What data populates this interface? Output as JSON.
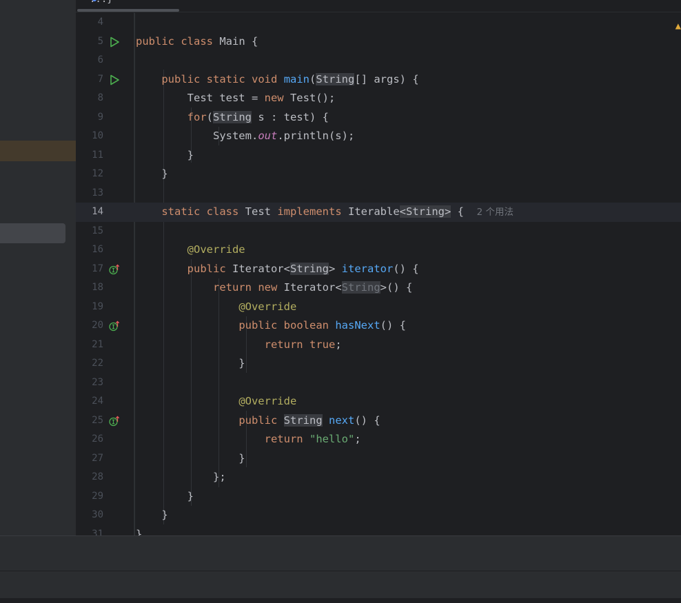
{
  "editor": {
    "tab": {
      "label": "...}"
    },
    "hint_text": "2 个用法",
    "colors": {
      "background": "#1e1f22",
      "keyword": "#cf8e6d",
      "method": "#56a8f5",
      "annotation": "#b3ae60",
      "string": "#6aab73",
      "static_field": "#c77dbb",
      "run_icon": "#4cae4f"
    },
    "lines": [
      {
        "n": "4",
        "code": ""
      },
      {
        "n": "5",
        "code": "public class Main {",
        "marker": "run"
      },
      {
        "n": "6",
        "code": ""
      },
      {
        "n": "7",
        "code": "    public static void main(String[] args) {",
        "marker": "run"
      },
      {
        "n": "8",
        "code": "        Test test = new Test();"
      },
      {
        "n": "9",
        "code": "        for(String s : test) {"
      },
      {
        "n": "10",
        "code": "            System.out.println(s);"
      },
      {
        "n": "11",
        "code": "        }"
      },
      {
        "n": "12",
        "code": "    }"
      },
      {
        "n": "13",
        "code": ""
      },
      {
        "n": "14",
        "code": "    static class Test implements Iterable<String> {  2 个用法"
      },
      {
        "n": "15",
        "code": ""
      },
      {
        "n": "16",
        "code": "        @Override"
      },
      {
        "n": "17",
        "code": "        public Iterator<String> iterator() {",
        "marker": "implements-up"
      },
      {
        "n": "18",
        "code": "            return new Iterator<String>() {"
      },
      {
        "n": "19",
        "code": "                @Override"
      },
      {
        "n": "20",
        "code": "                public boolean hasNext() {",
        "marker": "implements-up"
      },
      {
        "n": "21",
        "code": "                    return true;"
      },
      {
        "n": "22",
        "code": "                }"
      },
      {
        "n": "23",
        "code": ""
      },
      {
        "n": "24",
        "code": "                @Override"
      },
      {
        "n": "25",
        "code": "                public String next() {",
        "marker": "implements-up"
      },
      {
        "n": "26",
        "code": "                    return \"hello\";"
      },
      {
        "n": "27",
        "code": "                }"
      },
      {
        "n": "28",
        "code": "            };"
      },
      {
        "n": "29",
        "code": "        }"
      },
      {
        "n": "30",
        "code": "    }"
      },
      {
        "n": "31",
        "code": "}"
      }
    ]
  }
}
